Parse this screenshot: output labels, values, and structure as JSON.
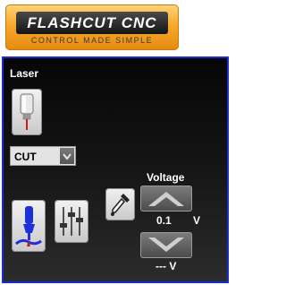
{
  "logo": {
    "title": "FLASHCUT CNC",
    "subtitle": "CONTROL MADE SIMPLE"
  },
  "panel": {
    "section_label": "Laser",
    "mode_select": {
      "value": "CUT"
    },
    "voltage": {
      "label": "Voltage",
      "value": "0.1",
      "unit": "V",
      "readout": "--- V"
    }
  },
  "icons": {
    "laser_head": "laser-head-icon",
    "plasma_torch": "torch-height-icon",
    "sliders": "sliders-icon",
    "dropper": "eyedropper-icon",
    "up": "arrow-up-icon",
    "down": "arrow-down-icon"
  },
  "colors": {
    "panel_border": "#1a2bd6",
    "logo_orange": "#f7a92a",
    "accent_blue": "#1a2bd6"
  }
}
